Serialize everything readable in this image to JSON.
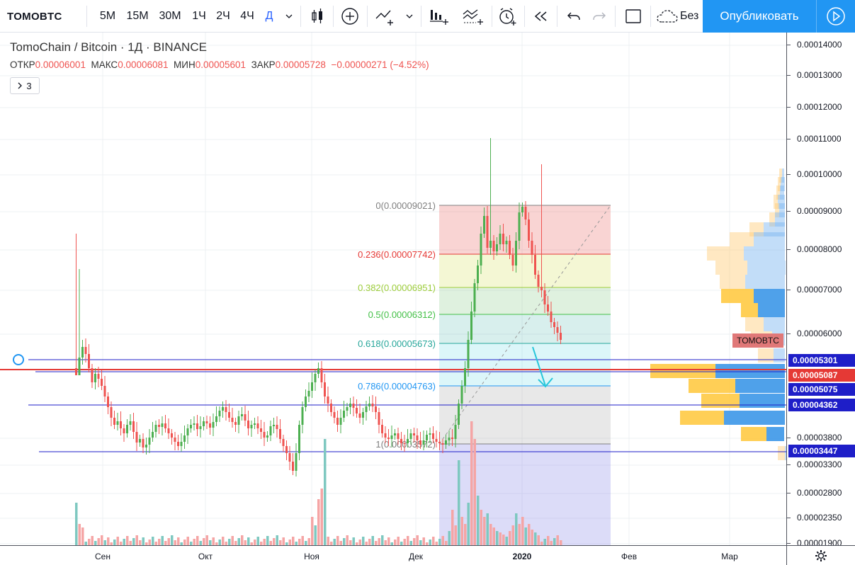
{
  "toolbar": {
    "symbol": "TOMOBTC",
    "intervals": [
      "5М",
      "15М",
      "30М",
      "1Ч",
      "2Ч",
      "4Ч",
      "Д"
    ],
    "active_interval": "Д",
    "template_label": "Без",
    "publish_label": "Опубликовать",
    "icons": [
      "candles-icon",
      "add-indicator-icon",
      "compare-icon",
      "financials-icon",
      "indicator-templates-icon",
      "alert-icon",
      "replay-icon",
      "undo-icon",
      "redo-icon",
      "layout-icon",
      "cloud-save-icon",
      "play-icon"
    ]
  },
  "legend": {
    "title": "TomoChain / Bitcoin · 1Д · BINANCE",
    "open_label": "ОТКР",
    "open": "0.00006001",
    "high_label": "МАКС",
    "high": "0.00006081",
    "low_label": "МИН",
    "low": "0.00005601",
    "close_label": "ЗАКР",
    "close": "0.00005728",
    "change": "−0.00000271 (−4.52%)",
    "collapsed_count": "3"
  },
  "fib_levels": [
    {
      "text": "0(0.00009021)",
      "price": 9.021e-05,
      "color": "#808080"
    },
    {
      "text": "0.236(0.00007742)",
      "price": 7.742e-05,
      "color": "#e53935"
    },
    {
      "text": "0.382(0.00006951)",
      "price": 6.951e-05,
      "color": "#9ccc3a"
    },
    {
      "text": "0.5(0.00006312)",
      "price": 6.312e-05,
      "color": "#43c047"
    },
    {
      "text": "0.618(0.00005673)",
      "price": 5.673e-05,
      "color": "#26a69a"
    },
    {
      "text": "0.786(0.00004763)",
      "price": 4.763e-05,
      "color": "#2196f3"
    },
    {
      "text": "1(0.00003572)",
      "price": 3.572e-05,
      "color": "#808080"
    }
  ],
  "price_axis": {
    "ticks": [
      "0.00014000",
      "0.00013000",
      "0.00012000",
      "0.00011000",
      "0.00010000",
      "0.00009000",
      "0.00008000",
      "0.00007000",
      "0.00006000",
      "0.00003800",
      "0.00003300",
      "0.00002800",
      "0.00002350",
      "0.00001900"
    ],
    "labels": [
      {
        "text": "0.00005301",
        "color": "#1e1ec8"
      },
      {
        "text": "0.00005087",
        "color": "#e53935"
      },
      {
        "text": "0.00005075",
        "color": "#1e1ec8"
      },
      {
        "text": "0.00004362",
        "color": "#1e1ec8"
      },
      {
        "text": "0.00003447",
        "color": "#1e1ec8"
      }
    ],
    "symbol_tag": "TOMOBTC"
  },
  "time_axis": {
    "labels": [
      {
        "text": "Сен",
        "bold": false
      },
      {
        "text": "Окт",
        "bold": false
      },
      {
        "text": "Ноя",
        "bold": false
      },
      {
        "text": "Дек",
        "bold": false
      },
      {
        "text": "2020",
        "bold": true
      },
      {
        "text": "Фев",
        "bold": false
      },
      {
        "text": "Мар",
        "bold": false
      }
    ]
  },
  "colors": {
    "up": "#4caf50",
    "down": "#ef5350",
    "volume_up": "#7ec8c0",
    "volume_down": "#f5a5a5",
    "current_price": "#e53935",
    "horizontal_lines": "#1e1ec8",
    "accent": "#2196f3"
  }
}
